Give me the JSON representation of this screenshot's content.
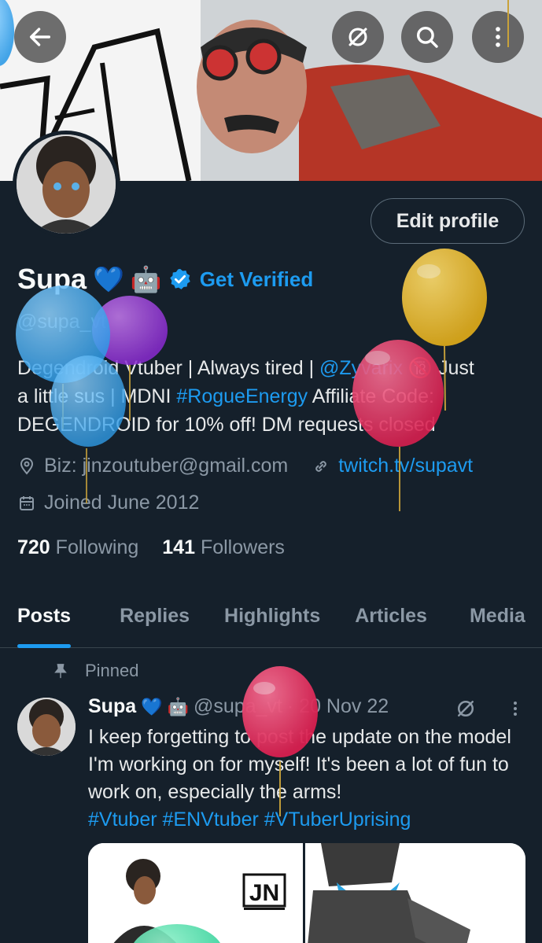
{
  "profile": {
    "name": "Supa",
    "get_verified": "Get Verified",
    "handle": "@supa_vt",
    "edit_profile": "Edit profile",
    "bio": {
      "line1_a": "Degendroid Vtuber | Always tired | ",
      "mention": "@Zyvarix",
      "line1_b": " 🔞 Just",
      "line2_a": "a little sus | MDNI ",
      "hashtag": "#RogueEnergy",
      "line2_b": " Affiliate Code:",
      "line3": "DEGENDROID for 10% off!  DM requests closed"
    },
    "biz": "Biz: jinzoutuber@gmail.com",
    "website": "twitch.tv/supavt",
    "joined": "Joined June 2012",
    "following_count": "720",
    "following_label": "Following",
    "followers_count": "141",
    "followers_label": "Followers"
  },
  "tabs": [
    {
      "label": "Posts",
      "active": true
    },
    {
      "label": "Replies"
    },
    {
      "label": "Highlights"
    },
    {
      "label": "Articles"
    },
    {
      "label": "Media"
    }
  ],
  "post": {
    "pinned_label": "Pinned",
    "author": "Supa",
    "handle": "@supa_vt",
    "date": "· 20 Nov 22",
    "text_1": "I keep forgetting to post the update on the model I'm working on for myself! It's been a lot of fun to work on, especially the arms!",
    "hashtags": "#Vtuber #ENVtuber #VTuberUprising",
    "media_logo": "JN"
  },
  "colors": {
    "background": "#15202b",
    "accent": "#1d9bf0",
    "muted": "#8b98a5"
  }
}
